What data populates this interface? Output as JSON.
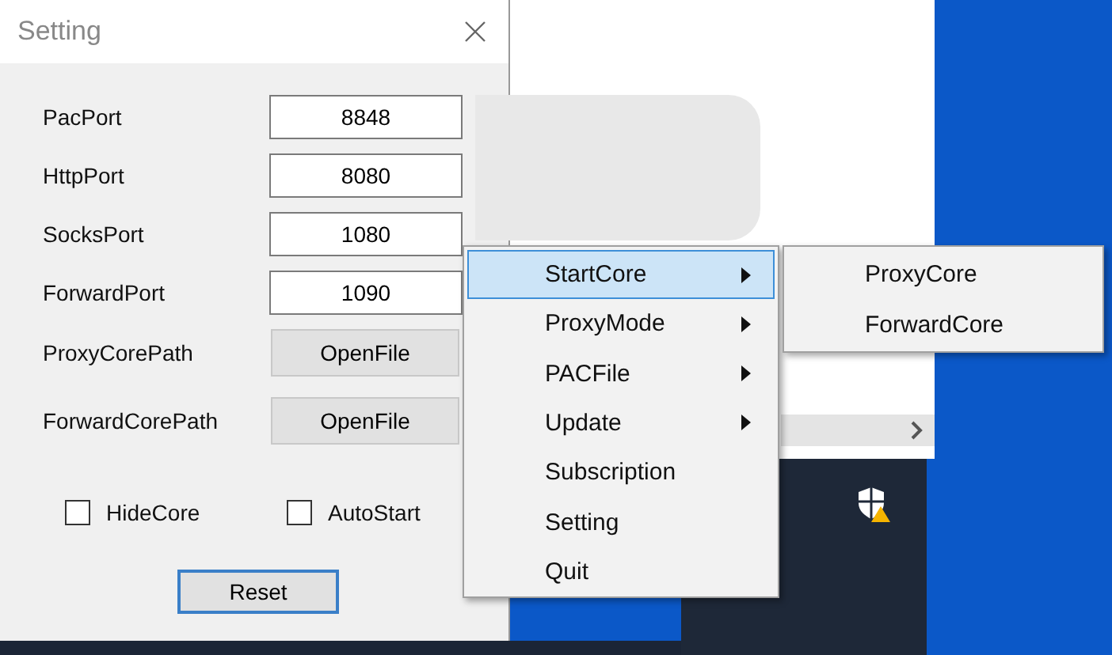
{
  "setting_window": {
    "title": "Setting",
    "port_fields": [
      {
        "label": "PacPort",
        "value": "8848"
      },
      {
        "label": "HttpPort",
        "value": "8080"
      },
      {
        "label": "SocksPort",
        "value": "1080"
      },
      {
        "label": "ForwardPort",
        "value": "1090"
      }
    ],
    "file_rows": [
      {
        "label": "ProxyCorePath",
        "button": "OpenFile"
      },
      {
        "label": "ForwardCorePath",
        "button": "OpenFile"
      }
    ],
    "checkboxes": [
      {
        "label": "HideCore",
        "checked": false
      },
      {
        "label": "AutoStart",
        "checked": false
      }
    ],
    "reset_button": "Reset"
  },
  "context_menu": {
    "items": [
      {
        "label": "StartCore",
        "has_submenu": true,
        "selected": true
      },
      {
        "label": "ProxyMode",
        "has_submenu": true,
        "selected": false
      },
      {
        "label": "PACFile",
        "has_submenu": true,
        "selected": false
      },
      {
        "label": "Update",
        "has_submenu": true,
        "selected": false
      },
      {
        "label": "Subscription",
        "has_submenu": false,
        "selected": false
      },
      {
        "label": "Setting",
        "has_submenu": false,
        "selected": false
      },
      {
        "label": "Quit",
        "has_submenu": false,
        "selected": false
      }
    ]
  },
  "submenu": {
    "items": [
      {
        "label": "ProxyCore",
        "selected": false
      },
      {
        "label": "ForwardCore",
        "selected": false
      }
    ]
  }
}
